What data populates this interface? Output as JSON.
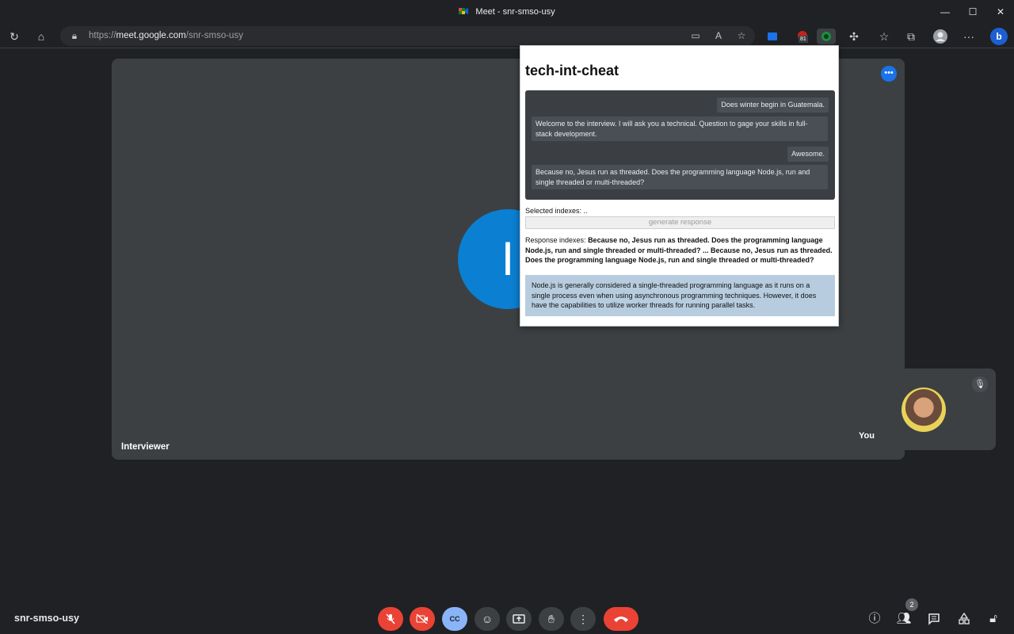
{
  "window": {
    "title": "Meet - snr-smso-usy"
  },
  "browser": {
    "url_prefix": "https://",
    "url_main": "meet.google.com",
    "url_suffix": "/snr-smso-usy",
    "ext_badge": "81"
  },
  "stage": {
    "avatar_initial": "I",
    "participant_label": "Interviewer"
  },
  "self_tile": {
    "label": "You"
  },
  "popup": {
    "title": "tech-int-cheat",
    "messages": [
      {
        "side": "right",
        "text": "Does winter begin in Guatemala."
      },
      {
        "side": "left",
        "text": "Welcome to the interview. I will ask you a technical. Question to gage your skills in full-stack development."
      },
      {
        "side": "right",
        "text": "Awesome."
      },
      {
        "side": "left",
        "text": "Because no, Jesus run as threaded. Does the programming language Node.js, run and single threaded or multi-threaded?"
      }
    ],
    "selected_label": "Selected indexes: ..",
    "generate_button": "generate response",
    "response_prefix": "Response indexes: ",
    "response_indexes": "Because no, Jesus run as threaded. Does the programming language Node.js, run and single threaded or multi-threaded? ... Because no, Jesus run as threaded. Does the programming language Node.js, run and single threaded or multi-threaded?",
    "answer": "Node.js is generally considered a single-threaded programming language as it runs on a single process even when using asynchronous programming techniques. However, it does have the capabilities to utilize worker threads for running parallel tasks."
  },
  "bottom_bar": {
    "meeting_code": "snr-smso-usy",
    "captions_label": "CC",
    "people_count": "2"
  },
  "colors": {
    "end_call": "#ea4335",
    "captions_active": "#8ab4f8",
    "avatar_bg": "#0b7fd1",
    "answer_bg": "#b7cddf"
  }
}
